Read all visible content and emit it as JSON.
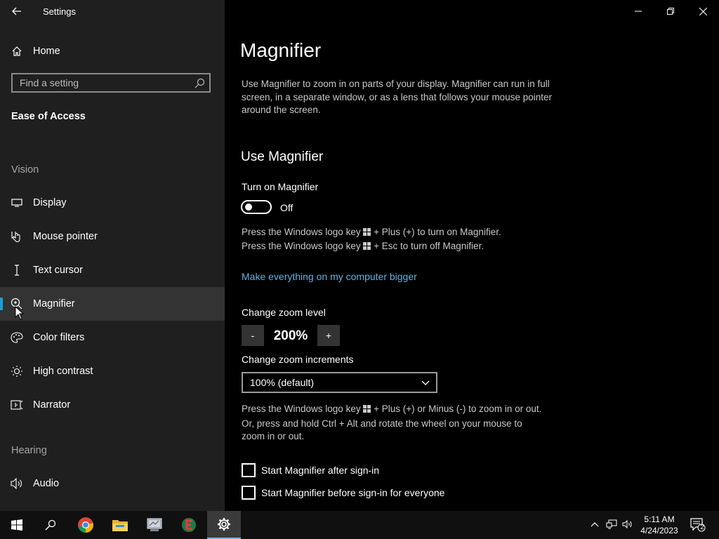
{
  "window": {
    "title": "Settings",
    "controls": [
      "minimize",
      "restore",
      "close"
    ]
  },
  "sidebar": {
    "home_label": "Home",
    "search_placeholder": "Find a setting",
    "section_title": "Ease of Access",
    "groups": {
      "vision": "Vision",
      "hearing": "Hearing"
    },
    "items": [
      {
        "label": "Display",
        "icon": "display-icon"
      },
      {
        "label": "Mouse pointer",
        "icon": "mouse-pointer-icon"
      },
      {
        "label": "Text cursor",
        "icon": "text-cursor-icon"
      },
      {
        "label": "Magnifier",
        "icon": "magnifier-icon",
        "selected": true
      },
      {
        "label": "Color filters",
        "icon": "color-filters-icon"
      },
      {
        "label": "High contrast",
        "icon": "high-contrast-icon"
      },
      {
        "label": "Narrator",
        "icon": "narrator-icon"
      },
      {
        "label": "Audio",
        "icon": "audio-icon"
      }
    ]
  },
  "main": {
    "title": "Magnifier",
    "description": "Use Magnifier to zoom in on parts of your display. Magnifier can run in full screen, in a separate window, or as a lens that follows your mouse pointer around the screen.",
    "use_heading": "Use Magnifier",
    "toggle": {
      "label": "Turn on Magnifier",
      "state": "Off"
    },
    "shortcut_hints": {
      "line1_pre": "Press the Windows logo key",
      "line1_post": "+ Plus (+) to turn on Magnifier.",
      "line2_pre": "Press the Windows logo key",
      "line2_post": "+ Esc to turn off Magnifier."
    },
    "link": "Make everything on my computer bigger",
    "zoom": {
      "label": "Change zoom level",
      "minus": "-",
      "value": "200%",
      "plus": "+"
    },
    "increments": {
      "label": "Change zoom increments",
      "selected": "100% (default)"
    },
    "zoom_hint": {
      "line1_pre": "Press the Windows logo key",
      "line1_post": "+ Plus (+) or Minus (-) to zoom in or out.",
      "line2": "Or, press and hold Ctrl + Alt and rotate the wheel on your mouse to",
      "line3": "zoom in or out."
    },
    "checkboxes": [
      {
        "label": "Start Magnifier after sign-in",
        "checked": false
      },
      {
        "label": "Start Magnifier before sign-in for everyone",
        "checked": false
      }
    ]
  },
  "taskbar": {
    "apps": [
      "start-icon",
      "search-icon",
      "chrome-icon",
      "file-explorer-icon",
      "network-app-icon",
      "game-app-icon",
      "settings-icon"
    ],
    "clock": {
      "time": "5:11 AM",
      "date": "4/24/2023"
    },
    "notification_count": "2"
  },
  "colors": {
    "accent": "#1a9fd6",
    "link": "#5fb2e0",
    "sidebar_bg": "#1f1f1f",
    "selected_bg": "#333333"
  }
}
